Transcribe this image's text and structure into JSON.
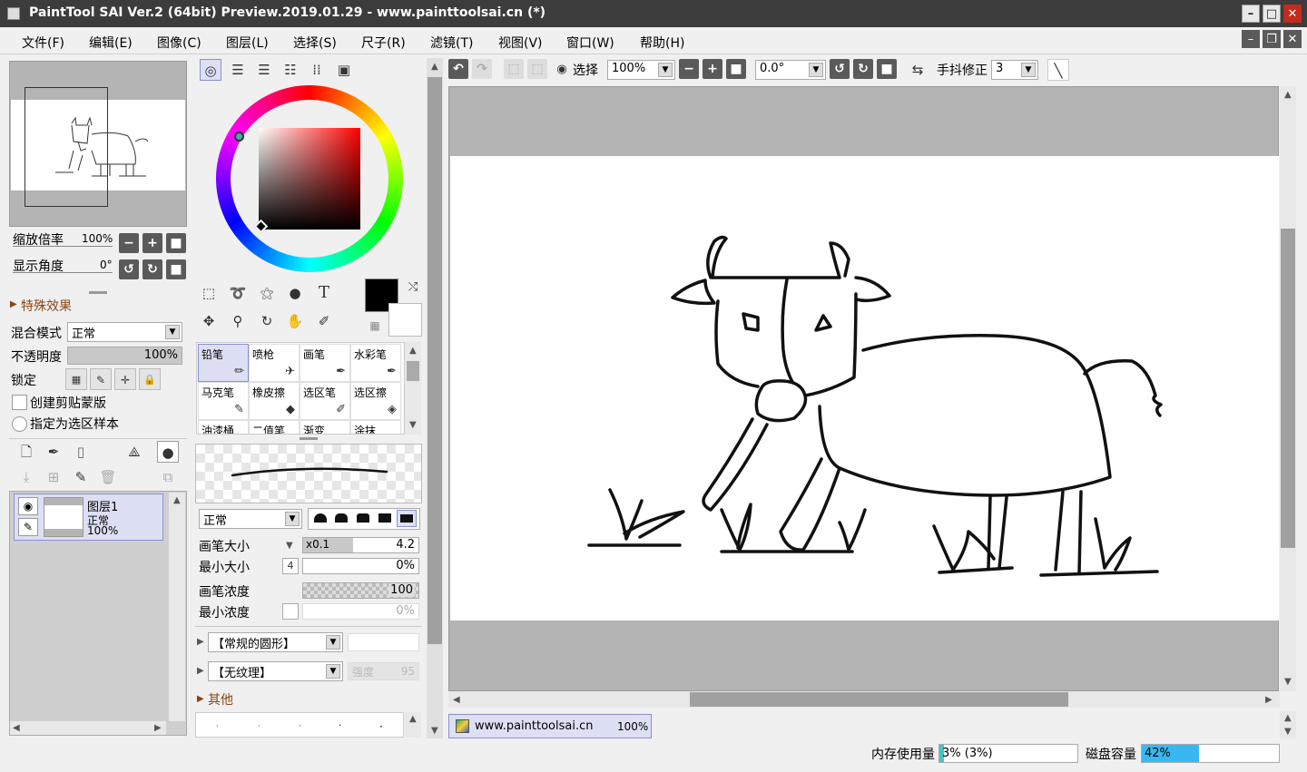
{
  "window": {
    "title": "PaintTool SAI Ver.2 (64bit) Preview.2019.01.29 - www.painttoolsai.cn (*)"
  },
  "menu": [
    "文件(F)",
    "编辑(E)",
    "图像(C)",
    "图层(L)",
    "选择(S)",
    "尺子(R)",
    "滤镜(T)",
    "视图(V)",
    "窗口(W)",
    "帮助(H)"
  ],
  "navigator": {
    "zoom_label": "缩放倍率",
    "zoom_value": "100%",
    "angle_label": "显示角度",
    "angle_value": "0°"
  },
  "layer_panel": {
    "effects": "特殊效果",
    "blend_label": "混合模式",
    "blend_value": "正常",
    "opacity_label": "不透明度",
    "opacity_value": "100%",
    "lock_label": "锁定",
    "clip_label": "创建剪贴蒙版",
    "sample_label": "指定为选区样本",
    "layer": {
      "name": "图层1",
      "mode": "正常",
      "opacity": "100%"
    }
  },
  "brushes": [
    {
      "name": "铅笔",
      "selected": true
    },
    {
      "name": "喷枪"
    },
    {
      "name": "画笔"
    },
    {
      "name": "水彩笔"
    },
    {
      "name": "马克笔"
    },
    {
      "name": "橡皮擦"
    },
    {
      "name": "选区笔"
    },
    {
      "name": "选区擦"
    },
    {
      "name": "油漆桶"
    },
    {
      "name": "二值笔"
    },
    {
      "name": "渐变"
    },
    {
      "name": "涂抹"
    }
  ],
  "tool_settings": {
    "mode": "正常",
    "size_label": "画笔大小",
    "size_mult": "x0.1",
    "size_value": "4.2",
    "min_size_label": "最小大小",
    "min_size_value": "0%",
    "density_label": "画笔浓度",
    "density_value": "100",
    "min_density_label": "最小浓度",
    "min_density_value": "0%",
    "shape": "【常规的圆形】",
    "texture": "【无纹理】",
    "strength_label": "强度",
    "strength_value": "95",
    "other_label": "其他"
  },
  "toolbar": {
    "select_label": "选择",
    "zoom_value": "100%",
    "angle_value": "0.0°",
    "stabilizer_label": "手抖修正",
    "stabilizer_value": "3"
  },
  "document_tab": {
    "name": "www.painttoolsai.cn",
    "zoom": "100%"
  },
  "status": {
    "memory_label": "内存使用量",
    "memory_value": "3% (3%)",
    "memory_fraction": 0.03,
    "disk_label": "磁盘容量",
    "disk_value": "42%",
    "disk_fraction": 0.42
  },
  "colors": {
    "primary": "#000000",
    "secondary": "#ffffff",
    "accent": "#8a8fd0",
    "disk_bar": "#38b8f0",
    "mem_bar": "#40c8c0"
  },
  "icons": [
    "eye-icon",
    "pencil-icon",
    "move-icon",
    "zoom-icon",
    "rotate-icon",
    "hand-icon",
    "eyedropper-icon",
    "text-icon",
    "wand-icon",
    "lasso-icon"
  ]
}
